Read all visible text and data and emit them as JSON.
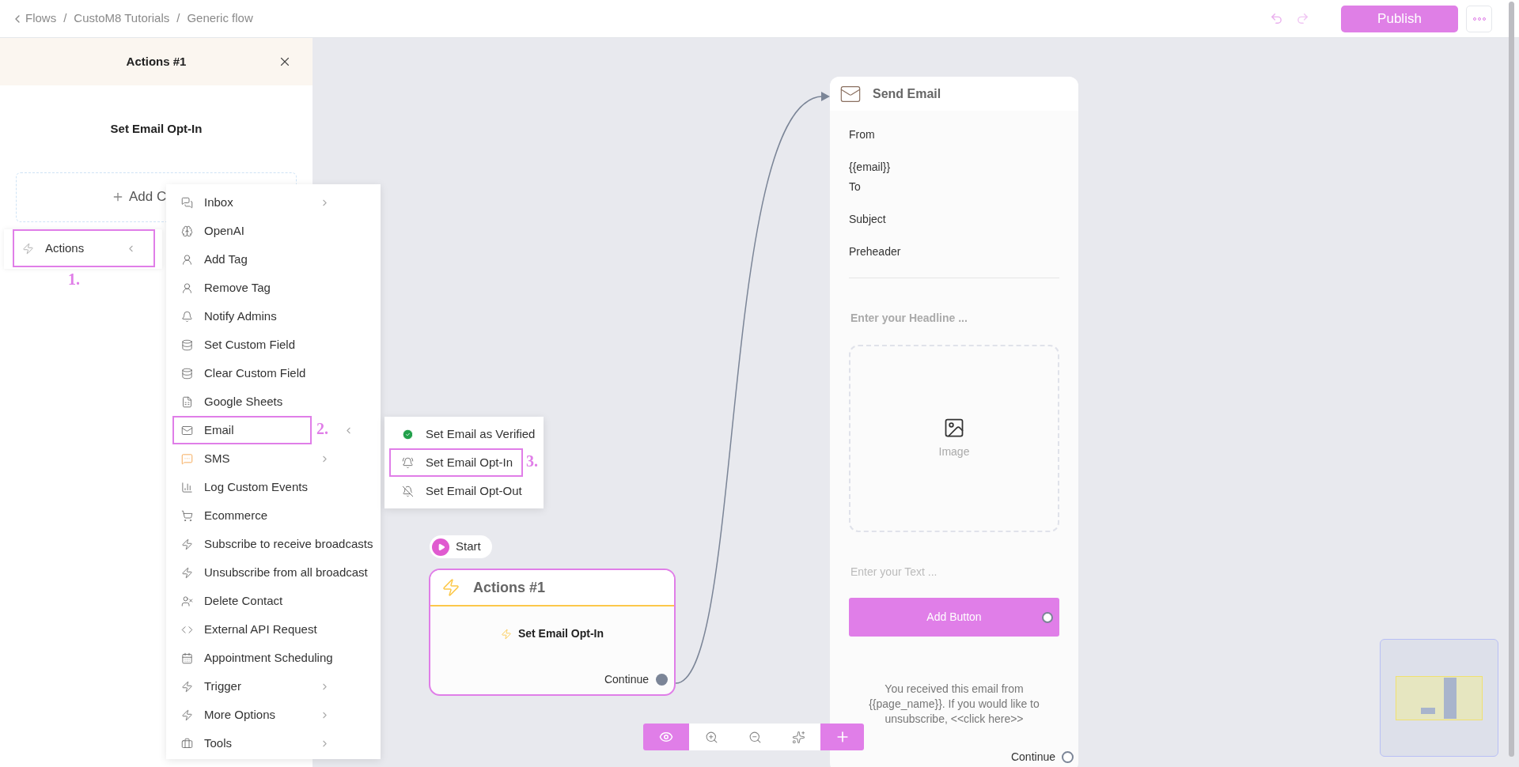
{
  "breadcrumb": {
    "items": [
      "Flows",
      "CustoM8 Tutorials",
      "Generic flow"
    ],
    "separator": "/"
  },
  "header": {
    "publish": "Publish"
  },
  "panel": {
    "title": "Actions #1",
    "action": "Set Email Opt-In",
    "add_button": "Add C",
    "category": {
      "label": "Actions",
      "selected": true,
      "step": "1."
    }
  },
  "menu": {
    "items": [
      {
        "label": "Inbox",
        "submenu": true,
        "selected": false
      },
      {
        "label": "OpenAI",
        "submenu": false,
        "selected": false
      },
      {
        "label": "Add Tag",
        "submenu": false,
        "selected": false
      },
      {
        "label": "Remove Tag",
        "submenu": false,
        "selected": false
      },
      {
        "label": "Notify Admins",
        "submenu": false,
        "selected": false
      },
      {
        "label": "Set Custom Field",
        "submenu": false,
        "selected": false
      },
      {
        "label": "Clear Custom Field",
        "submenu": false,
        "selected": false
      },
      {
        "label": "Google Sheets",
        "submenu": false,
        "selected": false
      },
      {
        "label": "Email",
        "submenu": true,
        "selected": true,
        "step": "2."
      },
      {
        "label": "SMS",
        "submenu": true,
        "selected": false
      },
      {
        "label": "Log Custom Events",
        "submenu": false,
        "selected": false
      },
      {
        "label": "Ecommerce",
        "submenu": false,
        "selected": false
      },
      {
        "label": "Subscribe to receive broadcasts",
        "submenu": false,
        "selected": false
      },
      {
        "label": "Unsubscribe from all broadcast",
        "submenu": false,
        "selected": false
      },
      {
        "label": "Delete Contact",
        "submenu": false,
        "selected": false
      },
      {
        "label": "External API Request",
        "submenu": false,
        "selected": false
      },
      {
        "label": "Appointment Scheduling",
        "submenu": false,
        "selected": false
      },
      {
        "label": "Trigger",
        "submenu": true,
        "selected": false
      },
      {
        "label": "More Options",
        "submenu": true,
        "selected": false
      },
      {
        "label": "Tools",
        "submenu": true,
        "selected": false
      }
    ]
  },
  "submenu": {
    "items": [
      {
        "label": "Set Email as Verified",
        "selected": false
      },
      {
        "label": "Set Email Opt-In",
        "selected": true,
        "step": "3."
      },
      {
        "label": "Set Email Opt-Out",
        "selected": false
      }
    ]
  },
  "canvas": {
    "start": "Start",
    "action_node": {
      "title": "Actions #1",
      "action": "Set Email Opt-In",
      "output": "Continue"
    },
    "email_node": {
      "title": "Send Email",
      "fields": [
        "From",
        "{{email}}",
        "To",
        "Subject",
        "Preheader"
      ],
      "headline_placeholder": "Enter your Headline ...",
      "image_label": "Image",
      "text_placeholder": "Enter your Text ...",
      "button": "Add Button",
      "footer": "You received this email from {{page_name}}. If you would like to unsubscribe, <<click here>>",
      "output": "Continue"
    }
  }
}
